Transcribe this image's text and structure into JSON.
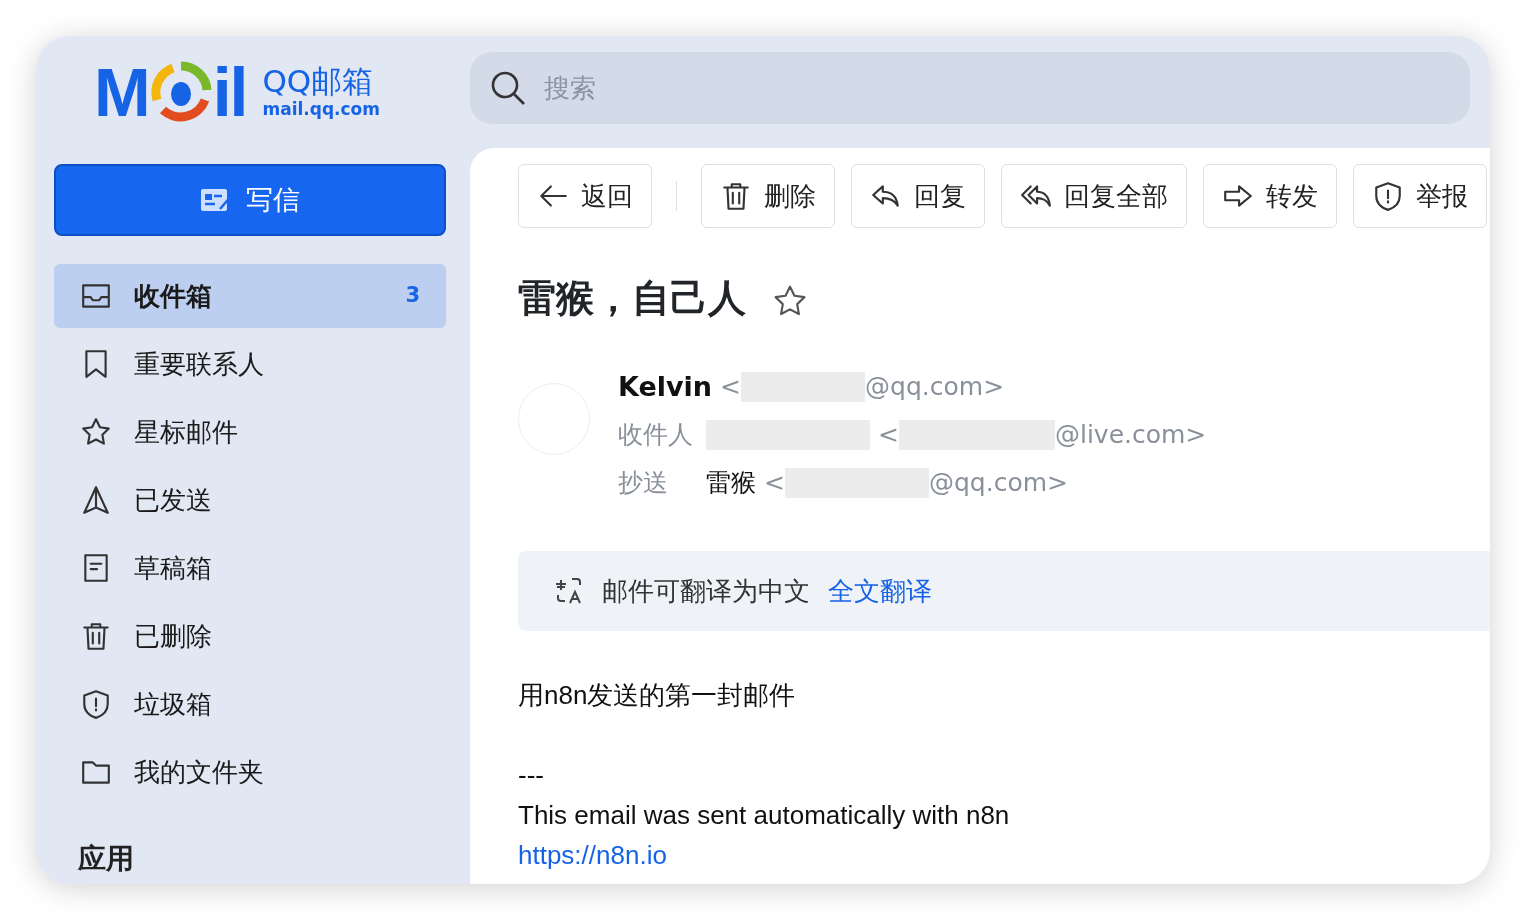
{
  "logo": {
    "mark_start": "M",
    "mark_end": "il",
    "title": "QQ邮箱",
    "domain": "mail.qq.com"
  },
  "compose_button": "写信",
  "folders": [
    {
      "label": "收件箱",
      "kind": "inbox",
      "selected": true,
      "count": "3"
    },
    {
      "label": "重要联系人",
      "kind": "bookmark",
      "selected": false
    },
    {
      "label": "星标邮件",
      "kind": "star",
      "selected": false
    },
    {
      "label": "已发送",
      "kind": "send",
      "selected": false
    },
    {
      "label": "草稿箱",
      "kind": "draft",
      "selected": false
    },
    {
      "label": "已删除",
      "kind": "trash",
      "selected": false
    },
    {
      "label": "垃圾箱",
      "kind": "shield",
      "selected": false
    },
    {
      "label": "我的文件夹",
      "kind": "folder",
      "selected": false
    }
  ],
  "apps_heading": "应用",
  "search": {
    "placeholder": "搜索"
  },
  "toolbar": [
    {
      "label": "返回",
      "kind": "back"
    },
    {
      "label": "删除",
      "kind": "trash"
    },
    {
      "label": "回复",
      "kind": "reply"
    },
    {
      "label": "回复全部",
      "kind": "replyall"
    },
    {
      "label": "转发",
      "kind": "forward"
    },
    {
      "label": "举报",
      "kind": "shield"
    }
  ],
  "subject": "雷猴，自己人",
  "starred": false,
  "from": {
    "name": "Kelvin",
    "open": "<",
    "address_end": "@qq.com>"
  },
  "to": {
    "label": "收件人",
    "open": "<",
    "address_end": "@live.com>"
  },
  "cc": {
    "label": "抄送",
    "name": "雷猴",
    "open": "<",
    "address_end": "@qq.com>"
  },
  "translate": {
    "text": "邮件可翻译为中文",
    "link": "全文翻译"
  },
  "body": [
    {
      "kind": "text",
      "text": "用n8n发送的第一封邮件"
    },
    {
      "kind": "gap"
    },
    {
      "kind": "text",
      "text": "---"
    },
    {
      "kind": "text",
      "text": "This email was sent automatically with n8n"
    },
    {
      "kind": "link",
      "text": "https://n8n.io"
    }
  ]
}
